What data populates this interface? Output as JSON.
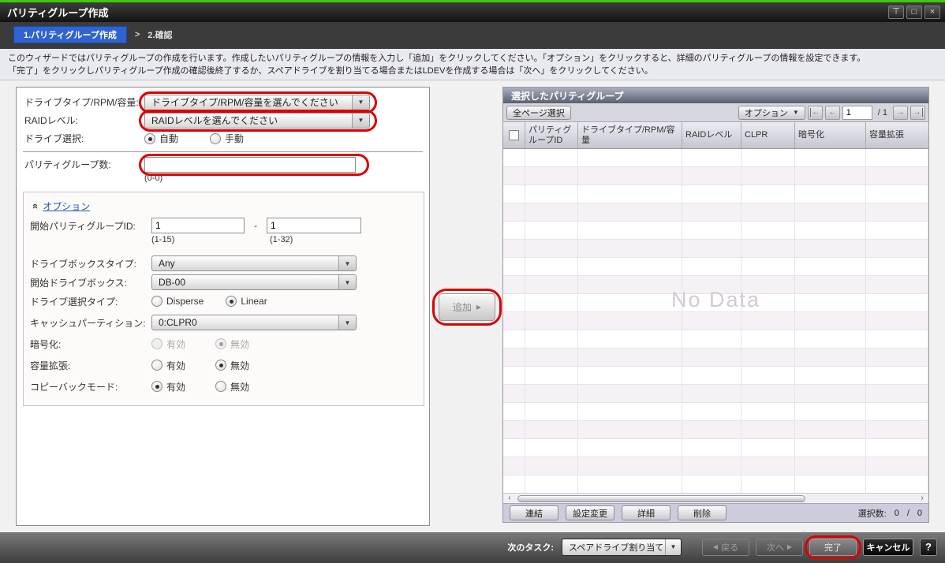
{
  "colors": {
    "accent_green": "#3bcb0c",
    "annotation_red": "#dd0000",
    "step_active_blue": "#2f63cf",
    "panel_header_gray": "#596070"
  },
  "window": {
    "title": "パリティグループ作成"
  },
  "icons": {
    "rollup": "⊤",
    "maximize": "□",
    "close": "×",
    "combo_arrow": "▼",
    "add_arrow": "▶",
    "back_arrow": "◀",
    "next_arrow": "▶",
    "collapse_chevron": "»",
    "page_prev": "←",
    "page_next": "→",
    "scroll_left": "‹",
    "scroll_right": "›",
    "help": "?"
  },
  "breadcrumb": {
    "step1": "1.パリティグループ作成",
    "separator": ">",
    "step2": "2.確認"
  },
  "description": {
    "line1": "このウィザードではパリティグループの作成を行います。作成したいパリティグループの情報を入力し「追加」をクリックしてください。「オプション」をクリックすると、詳細のパリティグループの情報を設定できます。",
    "line2": "「完了」をクリックしパリティグループ作成の確認後終了するか、スペアドライブを割り当てる場合またはLDEVを作成する場合は「次へ」をクリックしてください。"
  },
  "form": {
    "drive_type": {
      "label": "ドライブタイプ/RPM/容量:",
      "value": "ドライブタイプ/RPM/容量を選んでください"
    },
    "raid_level": {
      "label": "RAIDレベル:",
      "value": "RAIDレベルを選んでください"
    },
    "drive_selection": {
      "label": "ドライブ選択:",
      "options": [
        "自動",
        "手動"
      ],
      "selected": "自動"
    },
    "pg_count": {
      "label": "パリティグループ数:",
      "value": "",
      "hint": "(0-0)"
    },
    "options": {
      "toggle_label": "オプション",
      "start_pg_id": {
        "label": "開始パリティグループID:",
        "value1": "1",
        "separator": "-",
        "value2": "1",
        "hint1": "(1-15)",
        "hint2": "(1-32)"
      },
      "drive_box_type": {
        "label": "ドライブボックスタイプ:",
        "value": "Any"
      },
      "start_drive_box": {
        "label": "開始ドライブボックス:",
        "value": "DB-00"
      },
      "drive_selection_type": {
        "label": "ドライブ選択タイプ:",
        "options": [
          "Disperse",
          "Linear"
        ],
        "selected": "Linear"
      },
      "cache_partition": {
        "label": "キャッシュパーティション:",
        "value": "0:CLPR0"
      },
      "encryption": {
        "label": "暗号化:",
        "options": [
          "有効",
          "無効"
        ],
        "selected": "無効",
        "disabled": true
      },
      "capacity_expansion": {
        "label": "容量拡張:",
        "options": [
          "有効",
          "無効"
        ],
        "selected": "無効"
      },
      "copy_back_mode": {
        "label": "コピーバックモード:",
        "options": [
          "有効",
          "無効"
        ],
        "selected": "有効"
      }
    }
  },
  "add_button": {
    "label": "追加"
  },
  "table_panel": {
    "title": "選択したパリティグループ",
    "select_all_pages": "全ページ選択",
    "options_button": "オプション",
    "pagination": {
      "page": "1",
      "of": "/ 1"
    },
    "columns": [
      "パリティグループID",
      "ドライブタイプ/RPM/容量",
      "RAIDレベル",
      "CLPR",
      "暗号化",
      "容量拡張"
    ],
    "no_data": "No Data",
    "empty_rows": 19,
    "footer_buttons": [
      "連結",
      "設定変更",
      "詳細",
      "削除"
    ],
    "selected": {
      "label": "選択数:",
      "count": "0",
      "separator": "/",
      "total": "0"
    }
  },
  "footer": {
    "next_task_label": "次のタスク:",
    "next_task_value": "スペアドライブ割り当て",
    "back": "戻る",
    "next": "次へ",
    "finish": "完了",
    "cancel": "キャンセル"
  }
}
